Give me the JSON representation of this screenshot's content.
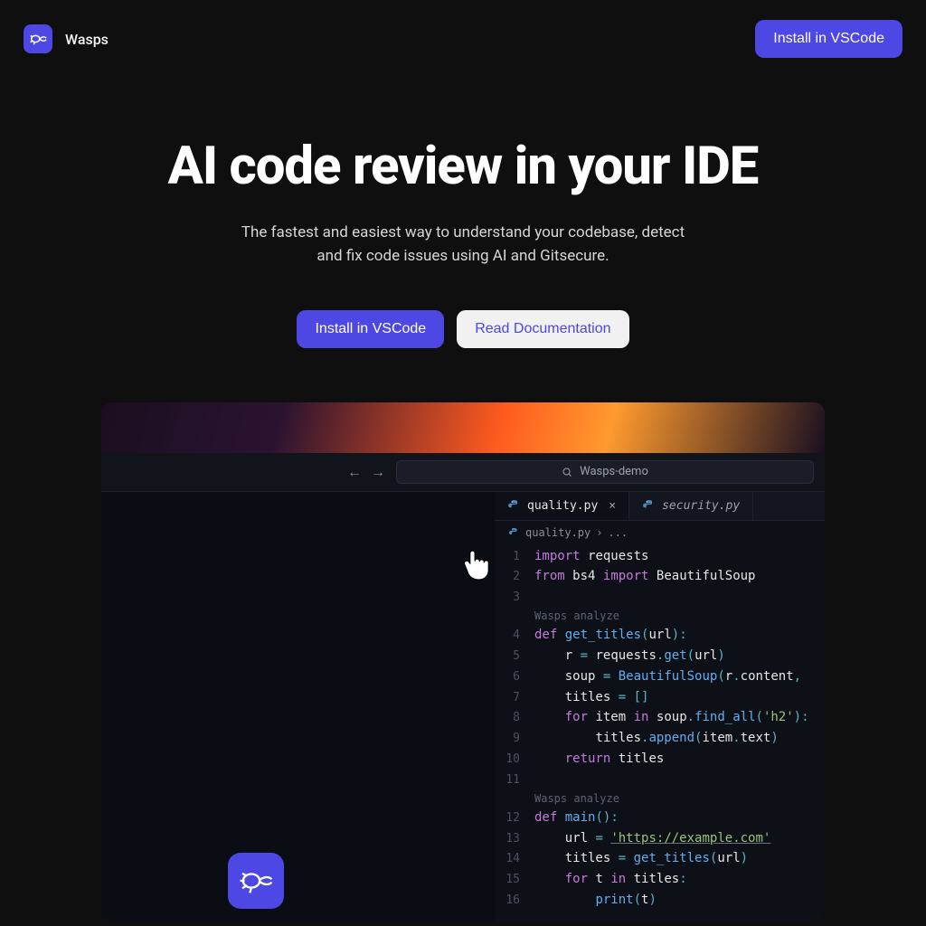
{
  "nav": {
    "brand_name": "Wasps",
    "install_label": "Install in VSCode"
  },
  "hero": {
    "title": "AI code review in your IDE",
    "subtitle": "The fastest and easiest way to understand your codebase, detect and fix code issues using AI and Gitsecure.",
    "primary_cta": "Install in VSCode",
    "secondary_cta": "Read Documentation"
  },
  "demo": {
    "search_placeholder": "Wasps-demo",
    "tabs": [
      {
        "label": "quality.py",
        "active": true
      },
      {
        "label": "security.py",
        "active": false
      }
    ],
    "breadcrumb": {
      "file": "quality.py",
      "tail": "..."
    },
    "hint_label": "Wasps analyze",
    "code_tokens": {
      "import": "import",
      "from": "from",
      "def": "def",
      "for": "for",
      "in": "in",
      "return": "return",
      "requests": "requests",
      "bs4": "bs4",
      "BeautifulSoup": "BeautifulSoup",
      "get_titles": "get_titles",
      "url": "url",
      "r": "r",
      "get": "get",
      "soup": "soup",
      "content": "content",
      "titles": "titles",
      "item": "item",
      "find_all": "find_all",
      "h2": "'h2'",
      "append": "append",
      "text": "text",
      "main": "main",
      "example_url": "'https://example.com'",
      "t": "t",
      "print": "print",
      "eq": "=",
      "colon": ":",
      "lpar": "(",
      "rpar": ")",
      "lbrk": "[",
      "rbrk": "]",
      "comma": ",",
      "dot": "."
    },
    "line_numbers": [
      "1",
      "2",
      "3",
      "4",
      "5",
      "6",
      "7",
      "8",
      "9",
      "10",
      "11",
      "12",
      "13",
      "14",
      "15",
      "16"
    ]
  },
  "colors": {
    "accent": "#4d47e4",
    "bg": "#0f0f10"
  }
}
